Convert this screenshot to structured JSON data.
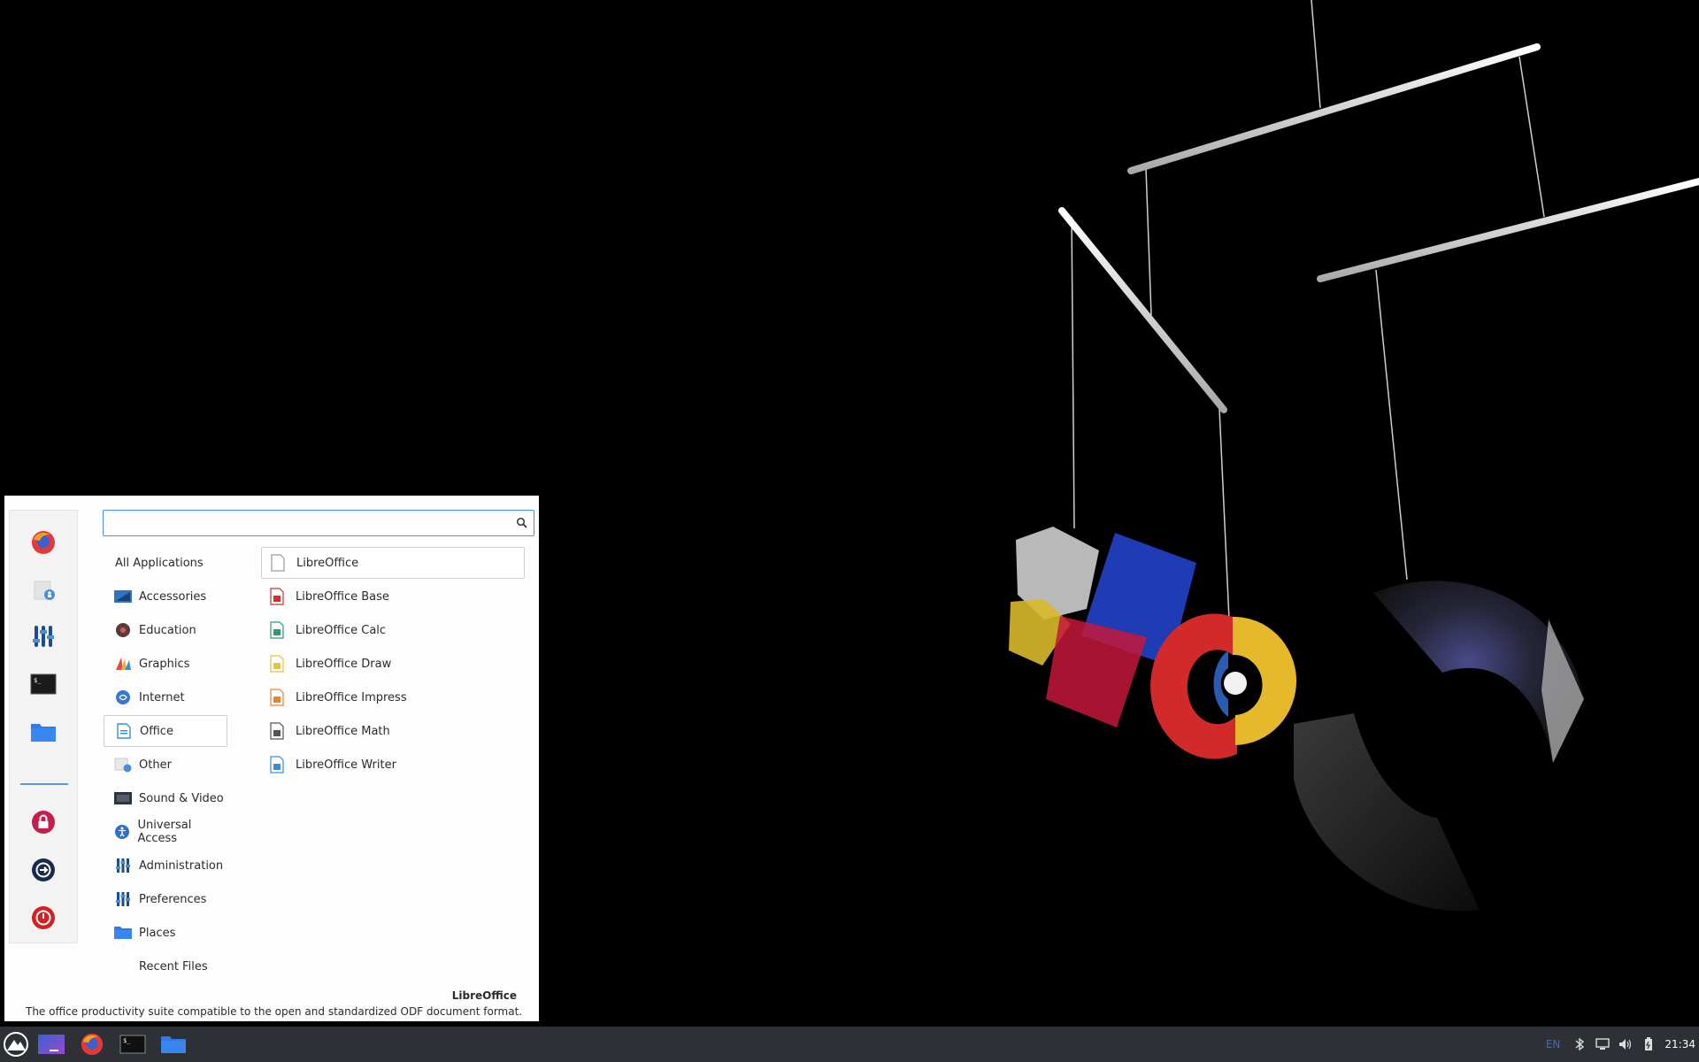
{
  "menu": {
    "search": {
      "placeholder": "",
      "value": ""
    },
    "categories": [
      {
        "label": "All Applications",
        "icon": "none"
      },
      {
        "label": "Accessories",
        "icon": "accessories-icon"
      },
      {
        "label": "Education",
        "icon": "education-icon"
      },
      {
        "label": "Graphics",
        "icon": "graphics-icon"
      },
      {
        "label": "Internet",
        "icon": "internet-icon"
      },
      {
        "label": "Office",
        "icon": "office-icon",
        "selected": true
      },
      {
        "label": "Other",
        "icon": "other-icon"
      },
      {
        "label": "Sound & Video",
        "icon": "sound-video-icon"
      },
      {
        "label": "Universal Access",
        "icon": "universal-access-icon"
      },
      {
        "label": "Administration",
        "icon": "administration-icon"
      },
      {
        "label": "Preferences",
        "icon": "preferences-icon"
      },
      {
        "label": "Places",
        "icon": "folder-icon"
      },
      {
        "label": "Recent Files",
        "icon": "none"
      }
    ],
    "apps": [
      {
        "label": "LibreOffice",
        "icon": "libreoffice-icon",
        "color": "#9a9a9a",
        "selected": true
      },
      {
        "label": "LibreOffice Base",
        "icon": "libreoffice-base-icon",
        "color": "#d32f2f"
      },
      {
        "label": "LibreOffice Calc",
        "icon": "libreoffice-calc-icon",
        "color": "#2e9e6a"
      },
      {
        "label": "LibreOffice Draw",
        "icon": "libreoffice-draw-icon",
        "color": "#e8c43a"
      },
      {
        "label": "LibreOffice Impress",
        "icon": "libreoffice-impress-icon",
        "color": "#e8852a"
      },
      {
        "label": "LibreOffice Math",
        "icon": "libreoffice-math-icon",
        "color": "#555555"
      },
      {
        "label": "LibreOffice Writer",
        "icon": "libreoffice-writer-icon",
        "color": "#3a8fd4"
      }
    ],
    "description": {
      "title": "LibreOffice",
      "text": "The office productivity suite compatible to the open and standardized ODF document format. Supp..."
    },
    "side_panel": [
      "firefox-icon",
      "user-folder-icon",
      "settings-icon",
      "terminal-icon",
      "files-icon",
      "lock-icon",
      "logout-icon",
      "power-icon"
    ]
  },
  "taskbar": {
    "apps": [
      "menu-logo-icon",
      "workspace-icon",
      "firefox-icon",
      "terminal-icon",
      "files-icon"
    ],
    "tray": {
      "language": "EN",
      "icons": [
        "bluetooth-icon",
        "display-icon",
        "volume-icon",
        "battery-icon"
      ],
      "clock": "21:34"
    }
  },
  "colors": {
    "accent": "#4a90d9",
    "taskbar": "#2d3035",
    "menu_bg": "#fdfdfd"
  }
}
